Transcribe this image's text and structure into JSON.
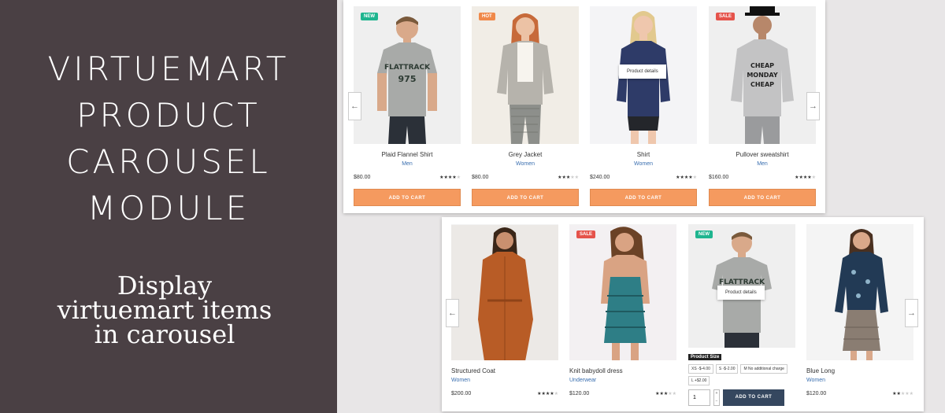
{
  "promo": {
    "title_lines": [
      "VIRTUEMART",
      "PRODUCT",
      "CAROUSEL",
      "MODULE"
    ],
    "subtitle_lines": [
      "Display",
      "virtuemart items",
      "in carousel"
    ]
  },
  "colors": {
    "panel": "#4a4044",
    "add_to_cart_orange": "#f59a5f",
    "add_to_cart_navy": "#35475f",
    "badge_new": "#1fb58f",
    "badge_hot": "#f0894a",
    "badge_sale": "#e5534b",
    "category_link": "#3a6fb0"
  },
  "carousel1": {
    "prev_icon": "arrow-left-icon",
    "next_icon": "arrow-right-icon",
    "popup": "Product details",
    "items": [
      {
        "badge": "NEW",
        "name": "Plaid Flannel Shirt",
        "category": "Men",
        "price": "$80.00",
        "rating": 4,
        "button": "ADD TO CART"
      },
      {
        "badge": "HOT",
        "name": "Grey Jacket",
        "category": "Women",
        "price": "$80.00",
        "rating": 3,
        "button": "ADD TO CART"
      },
      {
        "badge": "",
        "name": "Shirt",
        "category": "Women",
        "price": "$240.00",
        "rating": 4,
        "button": "ADD TO CART"
      },
      {
        "badge": "SALE",
        "name": "Pullover sweatshirt",
        "category": "Men",
        "price": "$160.00",
        "rating": 4,
        "button": "ADD TO CART"
      }
    ]
  },
  "carousel2": {
    "popup": "Product details",
    "items": [
      {
        "badge": "",
        "name": "Structured Coat",
        "category": "Women",
        "price": "$200.00",
        "rating": 4
      },
      {
        "badge": "SALE",
        "name": "Knit babydoll dress",
        "category": "Underwear",
        "price": "$120.00",
        "rating": 3
      },
      {
        "badge": "NEW",
        "name": "",
        "category": "",
        "price": "",
        "rating": 0
      },
      {
        "badge": "",
        "name": "Blue Long",
        "category": "Women",
        "price": "$120.00",
        "rating": 2
      }
    ],
    "options": {
      "label": "Product Size",
      "values": [
        "XS -$-4.00",
        "S -$-2.00",
        "M No additional charge",
        "L +$2.00"
      ],
      "quantity": "1",
      "button": "ADD TO CART"
    }
  }
}
